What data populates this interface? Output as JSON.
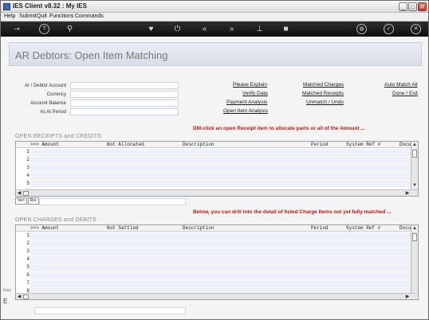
{
  "window": {
    "title": "IES Client v8.32 : My IES",
    "min": "_",
    "max": "□",
    "close": "✕"
  },
  "menu": [
    "Help",
    "Submit",
    "Quit",
    "Functions",
    "Commands"
  ],
  "toolbar_icons": [
    "key-icon",
    "help-icon",
    "search-icon",
    "heart-icon",
    "power-icon",
    "rewind-icon",
    "fast-forward-icon",
    "bookmark-icon",
    "stop-icon",
    "globe-icon",
    "check-icon",
    "close-icon"
  ],
  "page": {
    "title": "AR Debtors: Open Item Matching"
  },
  "fields": [
    {
      "label": "Ar / Debtor Account",
      "value": ""
    },
    {
      "label": "Currency",
      "value": ""
    },
    {
      "label": "Account Balance",
      "value": ""
    },
    {
      "label": "As At Period",
      "value": ""
    }
  ],
  "links": {
    "col1": [
      "Please Explain",
      "Verify Data",
      "Payment Analysis",
      "Open Item Analysis"
    ],
    "col2": [
      "Matched Charges",
      "Matched Receipts",
      "Unmatch / Undo"
    ],
    "col3": [
      "Auto Match All",
      "Done / Exit"
    ]
  },
  "hint1": "DM-click an open Receipt item to allocate   parts or all of the Amount ...",
  "hint2": "Below, you can drill into the detail  of listed Charge Items not  yet fully matched ...",
  "receipts": {
    "title": "OPEN RECEIPTS and CREDITS",
    "cols": [
      ">>> Amount",
      "Not Allocated",
      "Description",
      "Period",
      "System Ref #",
      "Docu"
    ],
    "rows": [
      "1",
      "2",
      "3",
      "4",
      "5",
      "6"
    ],
    "tabs": [
      "Ven",
      "Rre"
    ]
  },
  "charges": {
    "title": "OPEN CHARGES and DEBITS",
    "cols": [
      ">>> Amount",
      "Not Settled",
      "Description",
      "Period",
      "System Ref #",
      "Docu"
    ],
    "rows": [
      "1",
      "2",
      "3",
      "4",
      "5",
      "6",
      "7",
      "8"
    ]
  },
  "side": {
    "a": "Seq",
    "b": "E"
  }
}
